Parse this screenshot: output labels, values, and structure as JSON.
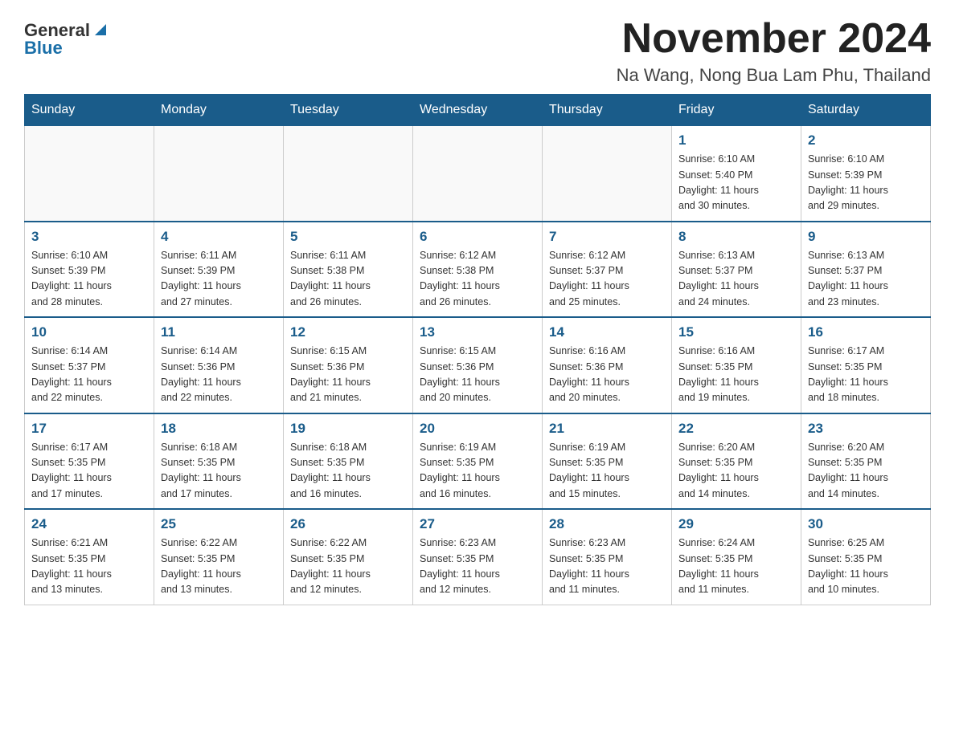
{
  "header": {
    "logo_general": "General",
    "logo_blue": "Blue",
    "month_title": "November 2024",
    "location": "Na Wang, Nong Bua Lam Phu, Thailand"
  },
  "weekdays": [
    "Sunday",
    "Monday",
    "Tuesday",
    "Wednesday",
    "Thursday",
    "Friday",
    "Saturday"
  ],
  "weeks": [
    [
      {
        "day": "",
        "info": ""
      },
      {
        "day": "",
        "info": ""
      },
      {
        "day": "",
        "info": ""
      },
      {
        "day": "",
        "info": ""
      },
      {
        "day": "",
        "info": ""
      },
      {
        "day": "1",
        "info": "Sunrise: 6:10 AM\nSunset: 5:40 PM\nDaylight: 11 hours\nand 30 minutes."
      },
      {
        "day": "2",
        "info": "Sunrise: 6:10 AM\nSunset: 5:39 PM\nDaylight: 11 hours\nand 29 minutes."
      }
    ],
    [
      {
        "day": "3",
        "info": "Sunrise: 6:10 AM\nSunset: 5:39 PM\nDaylight: 11 hours\nand 28 minutes."
      },
      {
        "day": "4",
        "info": "Sunrise: 6:11 AM\nSunset: 5:39 PM\nDaylight: 11 hours\nand 27 minutes."
      },
      {
        "day": "5",
        "info": "Sunrise: 6:11 AM\nSunset: 5:38 PM\nDaylight: 11 hours\nand 26 minutes."
      },
      {
        "day": "6",
        "info": "Sunrise: 6:12 AM\nSunset: 5:38 PM\nDaylight: 11 hours\nand 26 minutes."
      },
      {
        "day": "7",
        "info": "Sunrise: 6:12 AM\nSunset: 5:37 PM\nDaylight: 11 hours\nand 25 minutes."
      },
      {
        "day": "8",
        "info": "Sunrise: 6:13 AM\nSunset: 5:37 PM\nDaylight: 11 hours\nand 24 minutes."
      },
      {
        "day": "9",
        "info": "Sunrise: 6:13 AM\nSunset: 5:37 PM\nDaylight: 11 hours\nand 23 minutes."
      }
    ],
    [
      {
        "day": "10",
        "info": "Sunrise: 6:14 AM\nSunset: 5:37 PM\nDaylight: 11 hours\nand 22 minutes."
      },
      {
        "day": "11",
        "info": "Sunrise: 6:14 AM\nSunset: 5:36 PM\nDaylight: 11 hours\nand 22 minutes."
      },
      {
        "day": "12",
        "info": "Sunrise: 6:15 AM\nSunset: 5:36 PM\nDaylight: 11 hours\nand 21 minutes."
      },
      {
        "day": "13",
        "info": "Sunrise: 6:15 AM\nSunset: 5:36 PM\nDaylight: 11 hours\nand 20 minutes."
      },
      {
        "day": "14",
        "info": "Sunrise: 6:16 AM\nSunset: 5:36 PM\nDaylight: 11 hours\nand 20 minutes."
      },
      {
        "day": "15",
        "info": "Sunrise: 6:16 AM\nSunset: 5:35 PM\nDaylight: 11 hours\nand 19 minutes."
      },
      {
        "day": "16",
        "info": "Sunrise: 6:17 AM\nSunset: 5:35 PM\nDaylight: 11 hours\nand 18 minutes."
      }
    ],
    [
      {
        "day": "17",
        "info": "Sunrise: 6:17 AM\nSunset: 5:35 PM\nDaylight: 11 hours\nand 17 minutes."
      },
      {
        "day": "18",
        "info": "Sunrise: 6:18 AM\nSunset: 5:35 PM\nDaylight: 11 hours\nand 17 minutes."
      },
      {
        "day": "19",
        "info": "Sunrise: 6:18 AM\nSunset: 5:35 PM\nDaylight: 11 hours\nand 16 minutes."
      },
      {
        "day": "20",
        "info": "Sunrise: 6:19 AM\nSunset: 5:35 PM\nDaylight: 11 hours\nand 16 minutes."
      },
      {
        "day": "21",
        "info": "Sunrise: 6:19 AM\nSunset: 5:35 PM\nDaylight: 11 hours\nand 15 minutes."
      },
      {
        "day": "22",
        "info": "Sunrise: 6:20 AM\nSunset: 5:35 PM\nDaylight: 11 hours\nand 14 minutes."
      },
      {
        "day": "23",
        "info": "Sunrise: 6:20 AM\nSunset: 5:35 PM\nDaylight: 11 hours\nand 14 minutes."
      }
    ],
    [
      {
        "day": "24",
        "info": "Sunrise: 6:21 AM\nSunset: 5:35 PM\nDaylight: 11 hours\nand 13 minutes."
      },
      {
        "day": "25",
        "info": "Sunrise: 6:22 AM\nSunset: 5:35 PM\nDaylight: 11 hours\nand 13 minutes."
      },
      {
        "day": "26",
        "info": "Sunrise: 6:22 AM\nSunset: 5:35 PM\nDaylight: 11 hours\nand 12 minutes."
      },
      {
        "day": "27",
        "info": "Sunrise: 6:23 AM\nSunset: 5:35 PM\nDaylight: 11 hours\nand 12 minutes."
      },
      {
        "day": "28",
        "info": "Sunrise: 6:23 AM\nSunset: 5:35 PM\nDaylight: 11 hours\nand 11 minutes."
      },
      {
        "day": "29",
        "info": "Sunrise: 6:24 AM\nSunset: 5:35 PM\nDaylight: 11 hours\nand 11 minutes."
      },
      {
        "day": "30",
        "info": "Sunrise: 6:25 AM\nSunset: 5:35 PM\nDaylight: 11 hours\nand 10 minutes."
      }
    ]
  ]
}
